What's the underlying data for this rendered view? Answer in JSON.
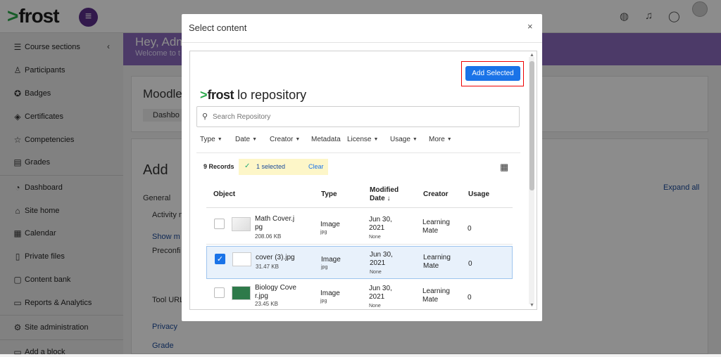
{
  "topbar": {
    "logo": "frost",
    "menu_icon": "hamburger-icon",
    "icons": [
      "globe-icon",
      "bell-icon",
      "chat-icon"
    ]
  },
  "banner": {
    "greeting": "Hey, Adm",
    "welcome": "Welcome to t"
  },
  "sidebar": {
    "items": [
      {
        "label": "Course sections",
        "icon": "list-icon"
      },
      {
        "label": "Participants",
        "icon": "user-icon"
      },
      {
        "label": "Badges",
        "icon": "badge-icon"
      },
      {
        "label": "Certificates",
        "icon": "certificate-icon"
      },
      {
        "label": "Competencies",
        "icon": "star-icon"
      },
      {
        "label": "Grades",
        "icon": "book-icon"
      },
      {
        "label": "Dashboard",
        "icon": "dashboard-icon"
      },
      {
        "label": "Site home",
        "icon": "home-icon"
      },
      {
        "label": "Calendar",
        "icon": "calendar-icon"
      },
      {
        "label": "Private files",
        "icon": "file-icon"
      },
      {
        "label": "Content bank",
        "icon": "box-icon"
      },
      {
        "label": "Reports & Analytics",
        "icon": "folder-icon"
      },
      {
        "label": "Site administration",
        "icon": "gear-icon"
      },
      {
        "label": "Add a block",
        "icon": "plus-icon"
      }
    ]
  },
  "background": {
    "course_title": "Moodle",
    "dashboard_tab": "Dashbo",
    "add_heading": "Add",
    "general": "General",
    "activity": "Activity n",
    "show_more": "Show m",
    "preconfig": "Preconfi",
    "tool_url": "Tool URL",
    "expand_all": "Expand all",
    "privacy": "Privacy",
    "grade": "Grade"
  },
  "modal": {
    "title": "Select content",
    "close": "×",
    "add_selected": "Add Selected",
    "repo_brand": "frost",
    "repo_suffix": "lo repository",
    "search_placeholder": "Search Repository",
    "filters": [
      "Type",
      "Date",
      "Creator",
      "Metadata",
      "License",
      "Usage",
      "More"
    ],
    "records": "9 Records",
    "selected_count": "1 selected",
    "clear": "Clear",
    "columns": {
      "object": "Object",
      "type": "Type",
      "modified": "Modified",
      "modified2": "Date ↓",
      "creator": "Creator",
      "usage": "Usage"
    },
    "rows": [
      {
        "name": "Math Cover.j",
        "name2": "pg",
        "size": "208.06 KB",
        "type": "Image",
        "subtype": "jpg",
        "date": "Jun 30,",
        "date2": "2021",
        "date_sub": "None",
        "creator": "Learning",
        "creator2": "Mate",
        "usage": "0",
        "checked": false
      },
      {
        "name": "cover (3).jpg",
        "name2": "",
        "size": "31.47 KB",
        "type": "Image",
        "subtype": "jpg",
        "date": "Jun 30,",
        "date2": "2021",
        "date_sub": "None",
        "creator": "Learning",
        "creator2": "Mate",
        "usage": "0",
        "checked": true
      },
      {
        "name": "Biology Cove",
        "name2": "r.jpg",
        "size": "23.45 KB",
        "type": "Image",
        "subtype": "jpg",
        "date": "Jun 30,",
        "date2": "2021",
        "date_sub": "None",
        "creator": "Learning",
        "creator2": "Mate",
        "usage": "0",
        "checked": false
      }
    ]
  },
  "colors": {
    "brand_purple": "#5b2e8a",
    "banner": "#8a6bbd",
    "accent_blue": "#1a73e8",
    "frost_green": "#2aa84a",
    "selected_pill": "#fdf6c8",
    "highlight_red": "#ee0000"
  }
}
